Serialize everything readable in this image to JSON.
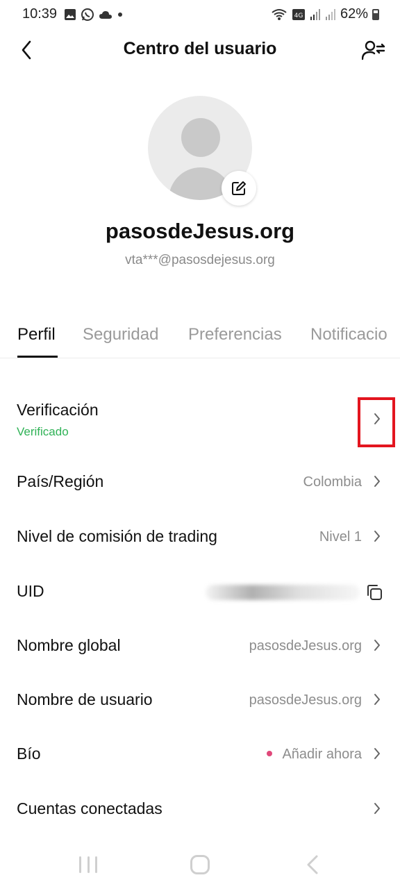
{
  "status_bar": {
    "time": "10:39",
    "battery": "62%"
  },
  "header": {
    "title": "Centro del usuario"
  },
  "profile": {
    "name": "pasosdeJesus.org",
    "email": "vta***@pasosdejesus.org"
  },
  "tabs": [
    {
      "label": "Perfil",
      "active": true
    },
    {
      "label": "Seguridad",
      "active": false
    },
    {
      "label": "Preferencias",
      "active": false
    },
    {
      "label": "Notificacio",
      "active": false
    }
  ],
  "rows": {
    "verification": {
      "label": "Verificación",
      "status": "Verificado"
    },
    "country": {
      "label": "País/Región",
      "value": "Colombia"
    },
    "fee_level": {
      "label": "Nivel de comisión de trading",
      "value": "Nivel 1"
    },
    "uid": {
      "label": "UID"
    },
    "global_name": {
      "label": "Nombre global",
      "value": "pasosdeJesus.org"
    },
    "username": {
      "label": "Nombre de usuario",
      "value": "pasosdeJesus.org"
    },
    "bio": {
      "label": "Bío",
      "value": "Añadir ahora"
    },
    "connected": {
      "label": "Cuentas conectadas"
    }
  },
  "colors": {
    "verified": "#2fb256",
    "highlight": "#e3151f",
    "bio_dot": "#e0487a"
  }
}
